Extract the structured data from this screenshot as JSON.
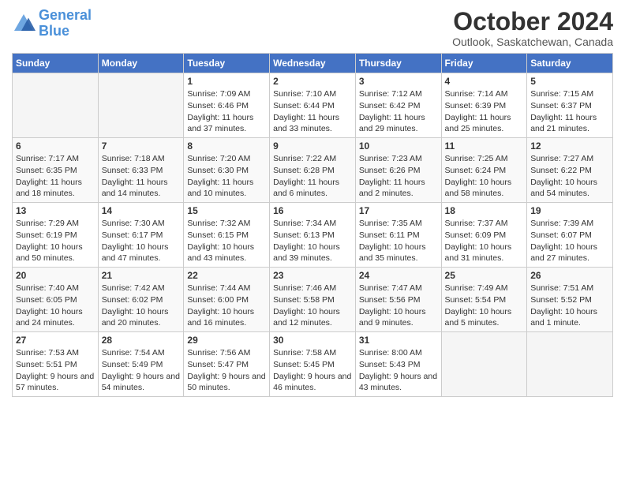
{
  "logo": {
    "line1": "General",
    "line2": "Blue"
  },
  "title": "October 2024",
  "subtitle": "Outlook, Saskatchewan, Canada",
  "header_days": [
    "Sunday",
    "Monday",
    "Tuesday",
    "Wednesday",
    "Thursday",
    "Friday",
    "Saturday"
  ],
  "weeks": [
    [
      {
        "day": null,
        "sunrise": null,
        "sunset": null,
        "daylight": null
      },
      {
        "day": null,
        "sunrise": null,
        "sunset": null,
        "daylight": null
      },
      {
        "day": "1",
        "sunrise": "Sunrise: 7:09 AM",
        "sunset": "Sunset: 6:46 PM",
        "daylight": "Daylight: 11 hours and 37 minutes."
      },
      {
        "day": "2",
        "sunrise": "Sunrise: 7:10 AM",
        "sunset": "Sunset: 6:44 PM",
        "daylight": "Daylight: 11 hours and 33 minutes."
      },
      {
        "day": "3",
        "sunrise": "Sunrise: 7:12 AM",
        "sunset": "Sunset: 6:42 PM",
        "daylight": "Daylight: 11 hours and 29 minutes."
      },
      {
        "day": "4",
        "sunrise": "Sunrise: 7:14 AM",
        "sunset": "Sunset: 6:39 PM",
        "daylight": "Daylight: 11 hours and 25 minutes."
      },
      {
        "day": "5",
        "sunrise": "Sunrise: 7:15 AM",
        "sunset": "Sunset: 6:37 PM",
        "daylight": "Daylight: 11 hours and 21 minutes."
      }
    ],
    [
      {
        "day": "6",
        "sunrise": "Sunrise: 7:17 AM",
        "sunset": "Sunset: 6:35 PM",
        "daylight": "Daylight: 11 hours and 18 minutes."
      },
      {
        "day": "7",
        "sunrise": "Sunrise: 7:18 AM",
        "sunset": "Sunset: 6:33 PM",
        "daylight": "Daylight: 11 hours and 14 minutes."
      },
      {
        "day": "8",
        "sunrise": "Sunrise: 7:20 AM",
        "sunset": "Sunset: 6:30 PM",
        "daylight": "Daylight: 11 hours and 10 minutes."
      },
      {
        "day": "9",
        "sunrise": "Sunrise: 7:22 AM",
        "sunset": "Sunset: 6:28 PM",
        "daylight": "Daylight: 11 hours and 6 minutes."
      },
      {
        "day": "10",
        "sunrise": "Sunrise: 7:23 AM",
        "sunset": "Sunset: 6:26 PM",
        "daylight": "Daylight: 11 hours and 2 minutes."
      },
      {
        "day": "11",
        "sunrise": "Sunrise: 7:25 AM",
        "sunset": "Sunset: 6:24 PM",
        "daylight": "Daylight: 10 hours and 58 minutes."
      },
      {
        "day": "12",
        "sunrise": "Sunrise: 7:27 AM",
        "sunset": "Sunset: 6:22 PM",
        "daylight": "Daylight: 10 hours and 54 minutes."
      }
    ],
    [
      {
        "day": "13",
        "sunrise": "Sunrise: 7:29 AM",
        "sunset": "Sunset: 6:19 PM",
        "daylight": "Daylight: 10 hours and 50 minutes."
      },
      {
        "day": "14",
        "sunrise": "Sunrise: 7:30 AM",
        "sunset": "Sunset: 6:17 PM",
        "daylight": "Daylight: 10 hours and 47 minutes."
      },
      {
        "day": "15",
        "sunrise": "Sunrise: 7:32 AM",
        "sunset": "Sunset: 6:15 PM",
        "daylight": "Daylight: 10 hours and 43 minutes."
      },
      {
        "day": "16",
        "sunrise": "Sunrise: 7:34 AM",
        "sunset": "Sunset: 6:13 PM",
        "daylight": "Daylight: 10 hours and 39 minutes."
      },
      {
        "day": "17",
        "sunrise": "Sunrise: 7:35 AM",
        "sunset": "Sunset: 6:11 PM",
        "daylight": "Daylight: 10 hours and 35 minutes."
      },
      {
        "day": "18",
        "sunrise": "Sunrise: 7:37 AM",
        "sunset": "Sunset: 6:09 PM",
        "daylight": "Daylight: 10 hours and 31 minutes."
      },
      {
        "day": "19",
        "sunrise": "Sunrise: 7:39 AM",
        "sunset": "Sunset: 6:07 PM",
        "daylight": "Daylight: 10 hours and 27 minutes."
      }
    ],
    [
      {
        "day": "20",
        "sunrise": "Sunrise: 7:40 AM",
        "sunset": "Sunset: 6:05 PM",
        "daylight": "Daylight: 10 hours and 24 minutes."
      },
      {
        "day": "21",
        "sunrise": "Sunrise: 7:42 AM",
        "sunset": "Sunset: 6:02 PM",
        "daylight": "Daylight: 10 hours and 20 minutes."
      },
      {
        "day": "22",
        "sunrise": "Sunrise: 7:44 AM",
        "sunset": "Sunset: 6:00 PM",
        "daylight": "Daylight: 10 hours and 16 minutes."
      },
      {
        "day": "23",
        "sunrise": "Sunrise: 7:46 AM",
        "sunset": "Sunset: 5:58 PM",
        "daylight": "Daylight: 10 hours and 12 minutes."
      },
      {
        "day": "24",
        "sunrise": "Sunrise: 7:47 AM",
        "sunset": "Sunset: 5:56 PM",
        "daylight": "Daylight: 10 hours and 9 minutes."
      },
      {
        "day": "25",
        "sunrise": "Sunrise: 7:49 AM",
        "sunset": "Sunset: 5:54 PM",
        "daylight": "Daylight: 10 hours and 5 minutes."
      },
      {
        "day": "26",
        "sunrise": "Sunrise: 7:51 AM",
        "sunset": "Sunset: 5:52 PM",
        "daylight": "Daylight: 10 hours and 1 minute."
      }
    ],
    [
      {
        "day": "27",
        "sunrise": "Sunrise: 7:53 AM",
        "sunset": "Sunset: 5:51 PM",
        "daylight": "Daylight: 9 hours and 57 minutes."
      },
      {
        "day": "28",
        "sunrise": "Sunrise: 7:54 AM",
        "sunset": "Sunset: 5:49 PM",
        "daylight": "Daylight: 9 hours and 54 minutes."
      },
      {
        "day": "29",
        "sunrise": "Sunrise: 7:56 AM",
        "sunset": "Sunset: 5:47 PM",
        "daylight": "Daylight: 9 hours and 50 minutes."
      },
      {
        "day": "30",
        "sunrise": "Sunrise: 7:58 AM",
        "sunset": "Sunset: 5:45 PM",
        "daylight": "Daylight: 9 hours and 46 minutes."
      },
      {
        "day": "31",
        "sunrise": "Sunrise: 8:00 AM",
        "sunset": "Sunset: 5:43 PM",
        "daylight": "Daylight: 9 hours and 43 minutes."
      },
      {
        "day": null,
        "sunrise": null,
        "sunset": null,
        "daylight": null
      },
      {
        "day": null,
        "sunrise": null,
        "sunset": null,
        "daylight": null
      }
    ]
  ]
}
